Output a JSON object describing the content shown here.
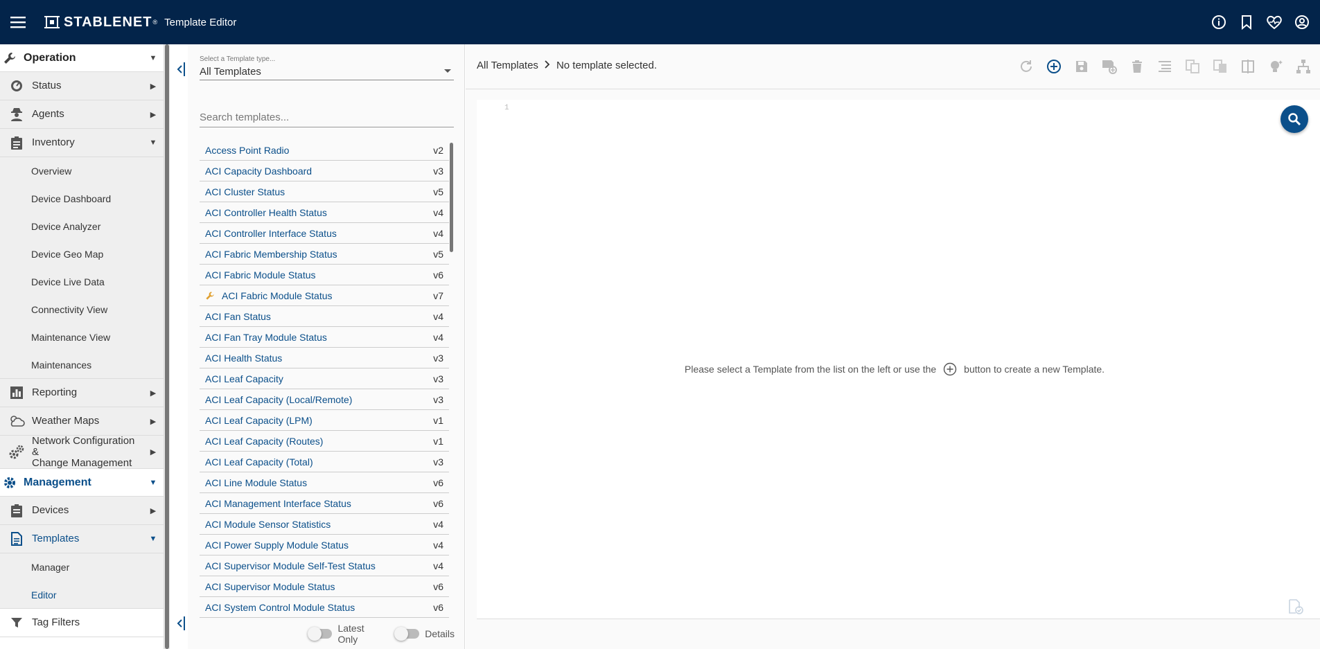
{
  "header": {
    "brand": "STABLENET",
    "brand_mark": "®",
    "app_title": "Template Editor",
    "icons": [
      "info-icon",
      "bookmark-icon",
      "health-icon",
      "account-icon"
    ]
  },
  "nav": {
    "operation": "Operation",
    "status": "Status",
    "agents": "Agents",
    "inventory": "Inventory",
    "inventory_items": [
      "Overview",
      "Device Dashboard",
      "Device Analyzer",
      "Device Geo Map",
      "Device Live Data",
      "Connectivity View",
      "Maintenance View",
      "Maintenances"
    ],
    "reporting": "Reporting",
    "weather_maps": "Weather Maps",
    "ncm_line1": "Network Configuration &",
    "ncm_line2": "Change Management",
    "management": "Management",
    "devices": "Devices",
    "templates": "Templates",
    "templates_items": [
      "Manager",
      "Editor"
    ],
    "tag_filters": "Tag Filters"
  },
  "list_panel": {
    "type_label": "Select a Template type...",
    "type_value": "All Templates",
    "search_placeholder": "Search templates...",
    "templates": [
      {
        "name": "Access Point Radio",
        "version": "v2",
        "wrench": false
      },
      {
        "name": "ACI Capacity Dashboard",
        "version": "v3",
        "wrench": false
      },
      {
        "name": "ACI Cluster Status",
        "version": "v5",
        "wrench": false
      },
      {
        "name": "ACI Controller Health Status",
        "version": "v4",
        "wrench": false
      },
      {
        "name": "ACI Controller Interface Status",
        "version": "v4",
        "wrench": false
      },
      {
        "name": "ACI Fabric Membership Status",
        "version": "v5",
        "wrench": false
      },
      {
        "name": "ACI Fabric Module Status",
        "version": "v6",
        "wrench": false
      },
      {
        "name": "ACI Fabric Module Status",
        "version": "v7",
        "wrench": true
      },
      {
        "name": "ACI Fan Status",
        "version": "v4",
        "wrench": false
      },
      {
        "name": "ACI Fan Tray Module Status",
        "version": "v4",
        "wrench": false
      },
      {
        "name": "ACI Health Status",
        "version": "v3",
        "wrench": false
      },
      {
        "name": "ACI Leaf Capacity",
        "version": "v3",
        "wrench": false
      },
      {
        "name": "ACI Leaf Capacity (Local/Remote)",
        "version": "v3",
        "wrench": false
      },
      {
        "name": "ACI Leaf Capacity (LPM)",
        "version": "v1",
        "wrench": false
      },
      {
        "name": "ACI Leaf Capacity (Routes)",
        "version": "v1",
        "wrench": false
      },
      {
        "name": "ACI Leaf Capacity (Total)",
        "version": "v3",
        "wrench": false
      },
      {
        "name": "ACI Line Module Status",
        "version": "v6",
        "wrench": false
      },
      {
        "name": "ACI Management Interface Status",
        "version": "v6",
        "wrench": false
      },
      {
        "name": "ACI Module Sensor Statistics",
        "version": "v4",
        "wrench": false
      },
      {
        "name": "ACI Power Supply Module Status",
        "version": "v4",
        "wrench": false
      },
      {
        "name": "ACI Supervisor Module Self-Test Status",
        "version": "v4",
        "wrench": false
      },
      {
        "name": "ACI Supervisor Module Status",
        "version": "v6",
        "wrench": false
      },
      {
        "name": "ACI System Control Module Status",
        "version": "v6",
        "wrench": false
      }
    ],
    "latest_only": "Latest Only",
    "details": "Details"
  },
  "editor": {
    "breadcrumb_root": "All Templates",
    "breadcrumb_current": "No template selected.",
    "line_number": "1",
    "message_before": "Please select a Template from the list on the left or use the",
    "message_after": "button to create a new Template.",
    "toolbar_icons": [
      "refresh-icon",
      "add-icon",
      "save-icon",
      "save-as-icon",
      "delete-icon",
      "format-icon",
      "copy-icon",
      "compare-icon",
      "split-view-icon",
      "hint-icon",
      "tree-icon"
    ]
  },
  "colors": {
    "topbar": "#03244a",
    "accent": "#0b4f8a",
    "wrench": "#e0a030"
  }
}
